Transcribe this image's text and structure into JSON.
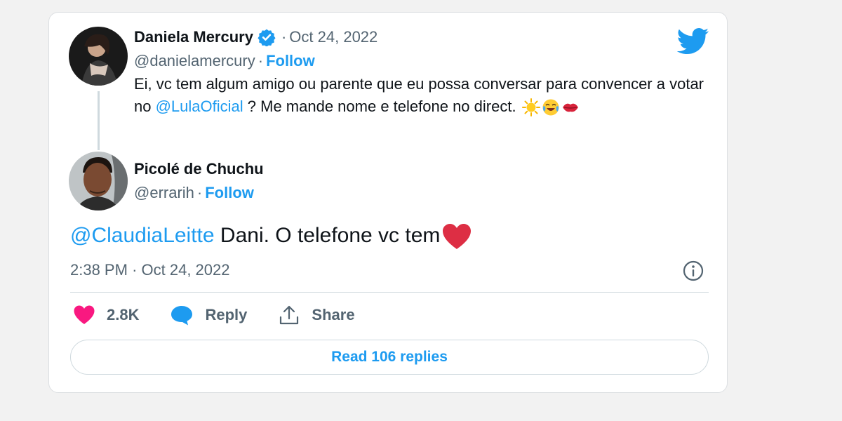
{
  "quoted": {
    "name": "Daniela Mercury",
    "separator": "·",
    "date": "Oct 24, 2022",
    "handle": "@danielamercury",
    "follow": "Follow",
    "text_before": "Ei, vc tem algum amigo ou parente que eu possa conversar para convencer a votar no ",
    "mention": "@LulaOficial",
    "text_after": " ? Me mande nome e telefone no direct. "
  },
  "reply": {
    "name": "Picolé de Chuchu",
    "handle": "@errarih",
    "separator": "·",
    "follow": "Follow",
    "mention": "@ClaudiaLeitte",
    "text": " Dani. O telefone vc tem",
    "time": "2:38 PM",
    "date": "Oct 24, 2022"
  },
  "actions": {
    "likes": "2.8K",
    "reply": "Reply",
    "share": "Share"
  },
  "read_replies": "Read 106 replies",
  "colors": {
    "accent": "#1d9bf0",
    "like": "#f91880",
    "text": "#0f1419",
    "secondary": "#536471"
  },
  "icons": [
    "twitter-bird-icon",
    "verified-badge-icon",
    "sun-emoji-icon",
    "laughing-emoji-icon",
    "kiss-emoji-icon",
    "heart-emoji-icon",
    "info-icon",
    "like-heart-icon",
    "reply-bubble-icon",
    "share-icon"
  ]
}
